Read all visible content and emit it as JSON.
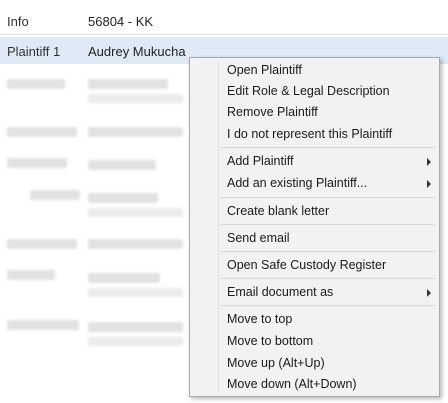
{
  "rows": {
    "info": {
      "label": "Info",
      "value": "56804 - KK"
    },
    "plaintiff": {
      "label": "Plaintiff 1",
      "value": "Audrey Mukucha"
    }
  },
  "context_menu": {
    "open_plaintiff": "Open Plaintiff",
    "edit_role": "Edit Role & Legal Description",
    "remove_plaintiff": "Remove Plaintiff",
    "not_represent": "I do not represent this Plaintiff",
    "add_plaintiff": "Add Plaintiff",
    "add_existing": "Add an existing Plaintiff...",
    "create_blank_letter": "Create blank letter",
    "send_email": "Send email",
    "open_safe_custody": "Open Safe Custody Register",
    "email_document_as": "Email document as",
    "move_to_top": "Move to top",
    "move_to_bottom": "Move to bottom",
    "move_up": "Move up (Alt+Up)",
    "move_down": "Move down (Alt+Down)"
  }
}
